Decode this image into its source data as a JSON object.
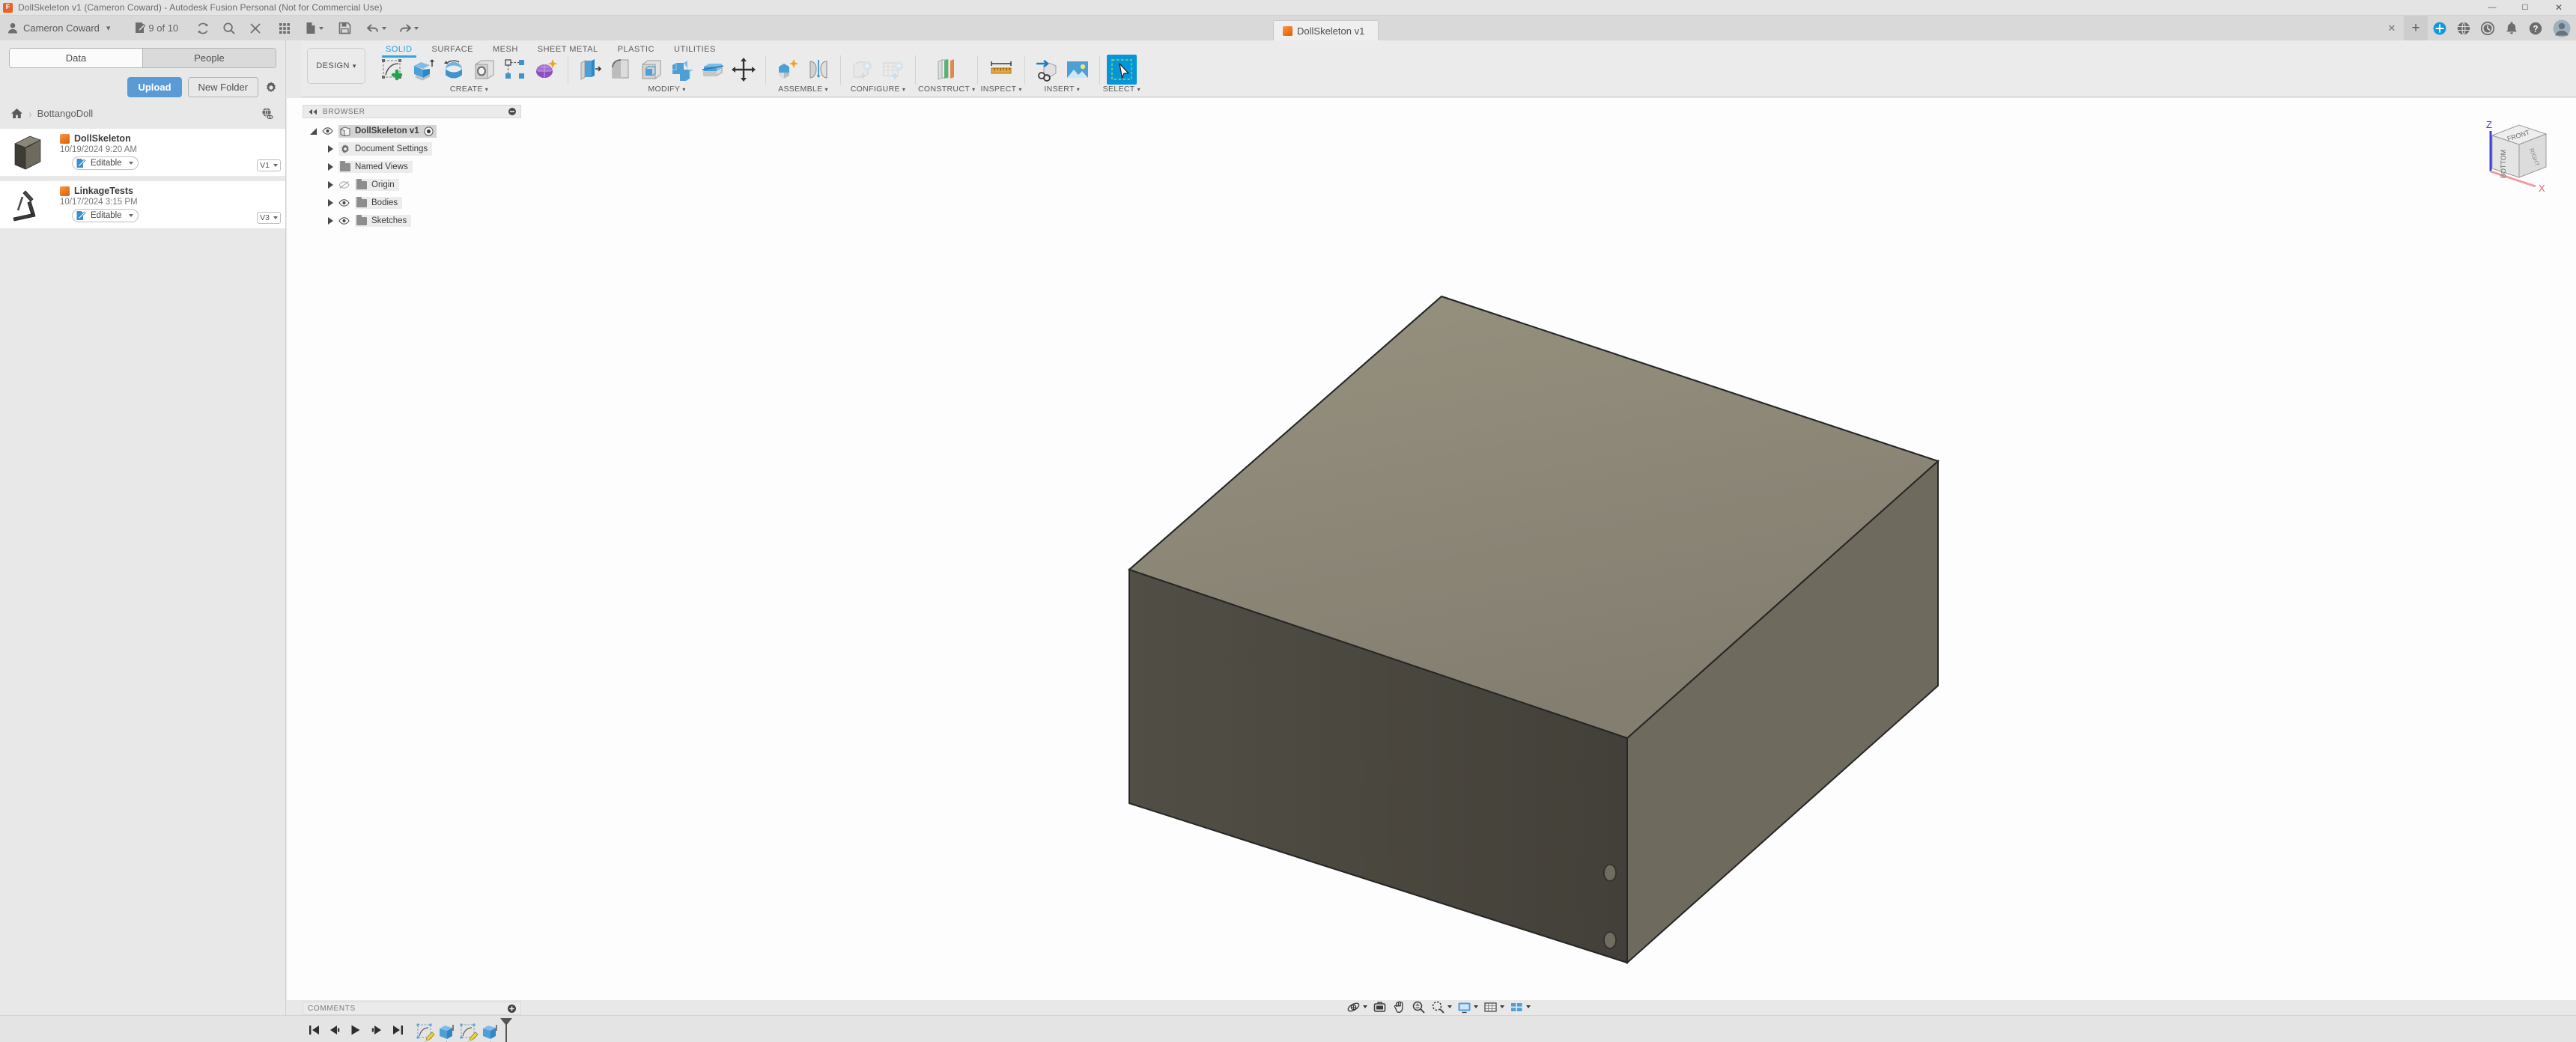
{
  "window": {
    "title": "DollSkeleton v1 (Cameron Coward) - Autodesk Fusion Personal (Not for Commercial Use)",
    "app_icon": "fusion-app-icon",
    "minimize": "—",
    "maximize": "☐",
    "close": "✕"
  },
  "quick_access": {
    "user_name": "Cameron Coward",
    "user_caret": "▾",
    "job_count": "9 of 10",
    "icons": [
      {
        "name": "job-status-icon",
        "label": "9 of 10"
      },
      {
        "name": "refresh-icon",
        "label": ""
      },
      {
        "name": "search-icon",
        "label": ""
      },
      {
        "name": "close-panel-icon",
        "label": ""
      },
      {
        "name": "grid-apps-icon",
        "label": ""
      },
      {
        "name": "new-document-icon",
        "label": ""
      },
      {
        "name": "save-icon",
        "label": ""
      },
      {
        "name": "undo-icon",
        "label": ""
      },
      {
        "name": "redo-icon",
        "label": ""
      }
    ]
  },
  "doc_tab": {
    "label": "DollSkeleton v1",
    "close": "✕",
    "new_tab": "+"
  },
  "account_bar": {
    "items": [
      {
        "name": "extension-manager-icon"
      },
      {
        "name": "globe-icon"
      },
      {
        "name": "recent-activity-icon"
      },
      {
        "name": "notifications-bell-icon"
      },
      {
        "name": "help-icon"
      },
      {
        "name": "user-avatar"
      }
    ]
  },
  "ribbon": {
    "workspace": "DESIGN",
    "workspace_caret": "▾",
    "tabs": [
      {
        "label": "SOLID",
        "active": true
      },
      {
        "label": "SURFACE",
        "active": false
      },
      {
        "label": "MESH",
        "active": false
      },
      {
        "label": "SHEET METAL",
        "active": false
      },
      {
        "label": "PLASTIC",
        "active": false
      },
      {
        "label": "UTILITIES",
        "active": false
      }
    ],
    "panels": [
      {
        "label": "CREATE",
        "caret": "▾",
        "tools": [
          {
            "name": "create-sketch-icon",
            "selected": false
          },
          {
            "name": "extrude-icon",
            "selected": false
          },
          {
            "name": "revolve-icon",
            "selected": false
          },
          {
            "name": "hole-icon",
            "selected": false
          },
          {
            "name": "rectangular-pattern-icon",
            "selected": false
          },
          {
            "name": "form-icon",
            "selected": false
          }
        ]
      },
      {
        "label": "MODIFY",
        "caret": "▾",
        "tools": [
          {
            "name": "press-pull-icon",
            "selected": false
          },
          {
            "name": "fillet-icon",
            "selected": false
          },
          {
            "name": "shell-icon",
            "selected": false
          },
          {
            "name": "combine-icon",
            "selected": false
          },
          {
            "name": "split-face-icon",
            "selected": false
          },
          {
            "name": "move-copy-icon",
            "selected": false
          }
        ]
      },
      {
        "label": "ASSEMBLE",
        "caret": "▾",
        "tools": [
          {
            "name": "new-component-icon",
            "selected": false
          },
          {
            "name": "joint-icon",
            "selected": false
          }
        ]
      },
      {
        "label": "CONFIGURE",
        "caret": "▾",
        "tools": [
          {
            "name": "configuration-icon",
            "selected": false
          },
          {
            "name": "configuration-table-icon",
            "selected": false
          }
        ]
      },
      {
        "label": "CONSTRUCT",
        "caret": "▾",
        "tools": [
          {
            "name": "offset-plane-icon",
            "selected": false
          }
        ]
      },
      {
        "label": "INSPECT",
        "caret": "▾",
        "tools": [
          {
            "name": "measure-icon",
            "selected": false
          }
        ]
      },
      {
        "label": "INSERT",
        "caret": "▾",
        "tools": [
          {
            "name": "insert-derive-icon",
            "selected": false
          },
          {
            "name": "insert-canvas-icon",
            "selected": false
          }
        ]
      },
      {
        "label": "SELECT",
        "caret": "▾",
        "tools": [
          {
            "name": "select-tool-icon",
            "selected": true
          }
        ]
      }
    ]
  },
  "data_panel": {
    "tabs": [
      {
        "label": "Data",
        "active": true
      },
      {
        "label": "People",
        "active": false
      }
    ],
    "upload_label": "Upload",
    "new_folder_label": "New Folder",
    "settings_icon": "gear-icon",
    "breadcrumb": {
      "home_icon": "home-icon",
      "separator": "›",
      "folder": "BottangoDoll",
      "share_icon": "share-globe-icon"
    },
    "files": [
      {
        "name": "DollSkeleton",
        "date": "10/19/2024 9:20 AM",
        "status": "Editable",
        "version": "V1",
        "thumb": "box-model-thumb"
      },
      {
        "name": "LinkageTests",
        "date": "10/17/2024 3:15 PM",
        "status": "Editable",
        "version": "V3",
        "thumb": "linkage-model-thumb"
      }
    ]
  },
  "browser": {
    "title": "BROWSER",
    "collapse_icon": "collapse-left-icon",
    "minimize_icon": "minimize-panel-icon",
    "tree": [
      {
        "label": "DollSkeleton v1",
        "icon": "component-icon",
        "eye": "visible",
        "depth": 0,
        "root": true,
        "radio": "activate-icon"
      },
      {
        "label": "Document Settings",
        "icon": "gear-icon",
        "eye": "none",
        "depth": 1,
        "root": false
      },
      {
        "label": "Named Views",
        "icon": "folder-icon",
        "eye": "none",
        "depth": 1,
        "root": false
      },
      {
        "label": "Origin",
        "icon": "folder-icon",
        "eye": "hidden",
        "depth": 1,
        "root": false
      },
      {
        "label": "Bodies",
        "icon": "folder-icon",
        "eye": "visible",
        "depth": 1,
        "root": false
      },
      {
        "label": "Sketches",
        "icon": "folder-icon",
        "eye": "visible",
        "depth": 1,
        "root": false
      }
    ]
  },
  "viewcube": {
    "faces": [
      "FRONT",
      "RIGHT",
      "BOTTOM"
    ],
    "axes": [
      {
        "label": "Z",
        "color": "#2b2bdd"
      },
      {
        "label": "X",
        "color": "#e05a6a"
      }
    ]
  },
  "model": {
    "name": "doll-skeleton-box",
    "top_face_color": "#8b8677",
    "left_face_color": "#4a473f",
    "right_face_color": "#6e6a5e",
    "edge_color": "#2b2b2b",
    "background": "#fdfdfd",
    "holes": 2
  },
  "comments": {
    "title": "COMMENTS",
    "add_icon": "add-comment-icon"
  },
  "nav_bar": {
    "items": [
      {
        "name": "orbit-icon",
        "caret": true
      },
      {
        "name": "look-at-icon",
        "caret": false
      },
      {
        "name": "pan-icon",
        "caret": false
      },
      {
        "name": "zoom-icon",
        "caret": false
      },
      {
        "name": "zoom-window-icon",
        "caret": true
      },
      {
        "name": "display-settings-icon",
        "caret": true
      },
      {
        "name": "grid-snaps-icon",
        "caret": true
      },
      {
        "name": "viewports-icon",
        "caret": true
      }
    ]
  },
  "timeline": {
    "controls": [
      {
        "name": "go-to-beginning-icon"
      },
      {
        "name": "step-back-icon"
      },
      {
        "name": "play-icon"
      },
      {
        "name": "step-forward-icon"
      },
      {
        "name": "go-to-end-icon"
      }
    ],
    "features": [
      {
        "name": "sketch-feature-1",
        "type": "sketch"
      },
      {
        "name": "extrude-feature-1",
        "type": "extrude"
      },
      {
        "name": "sketch-feature-2",
        "type": "sketch"
      },
      {
        "name": "extrude-feature-2",
        "type": "extrude"
      }
    ],
    "marker": "timeline-end-marker"
  }
}
